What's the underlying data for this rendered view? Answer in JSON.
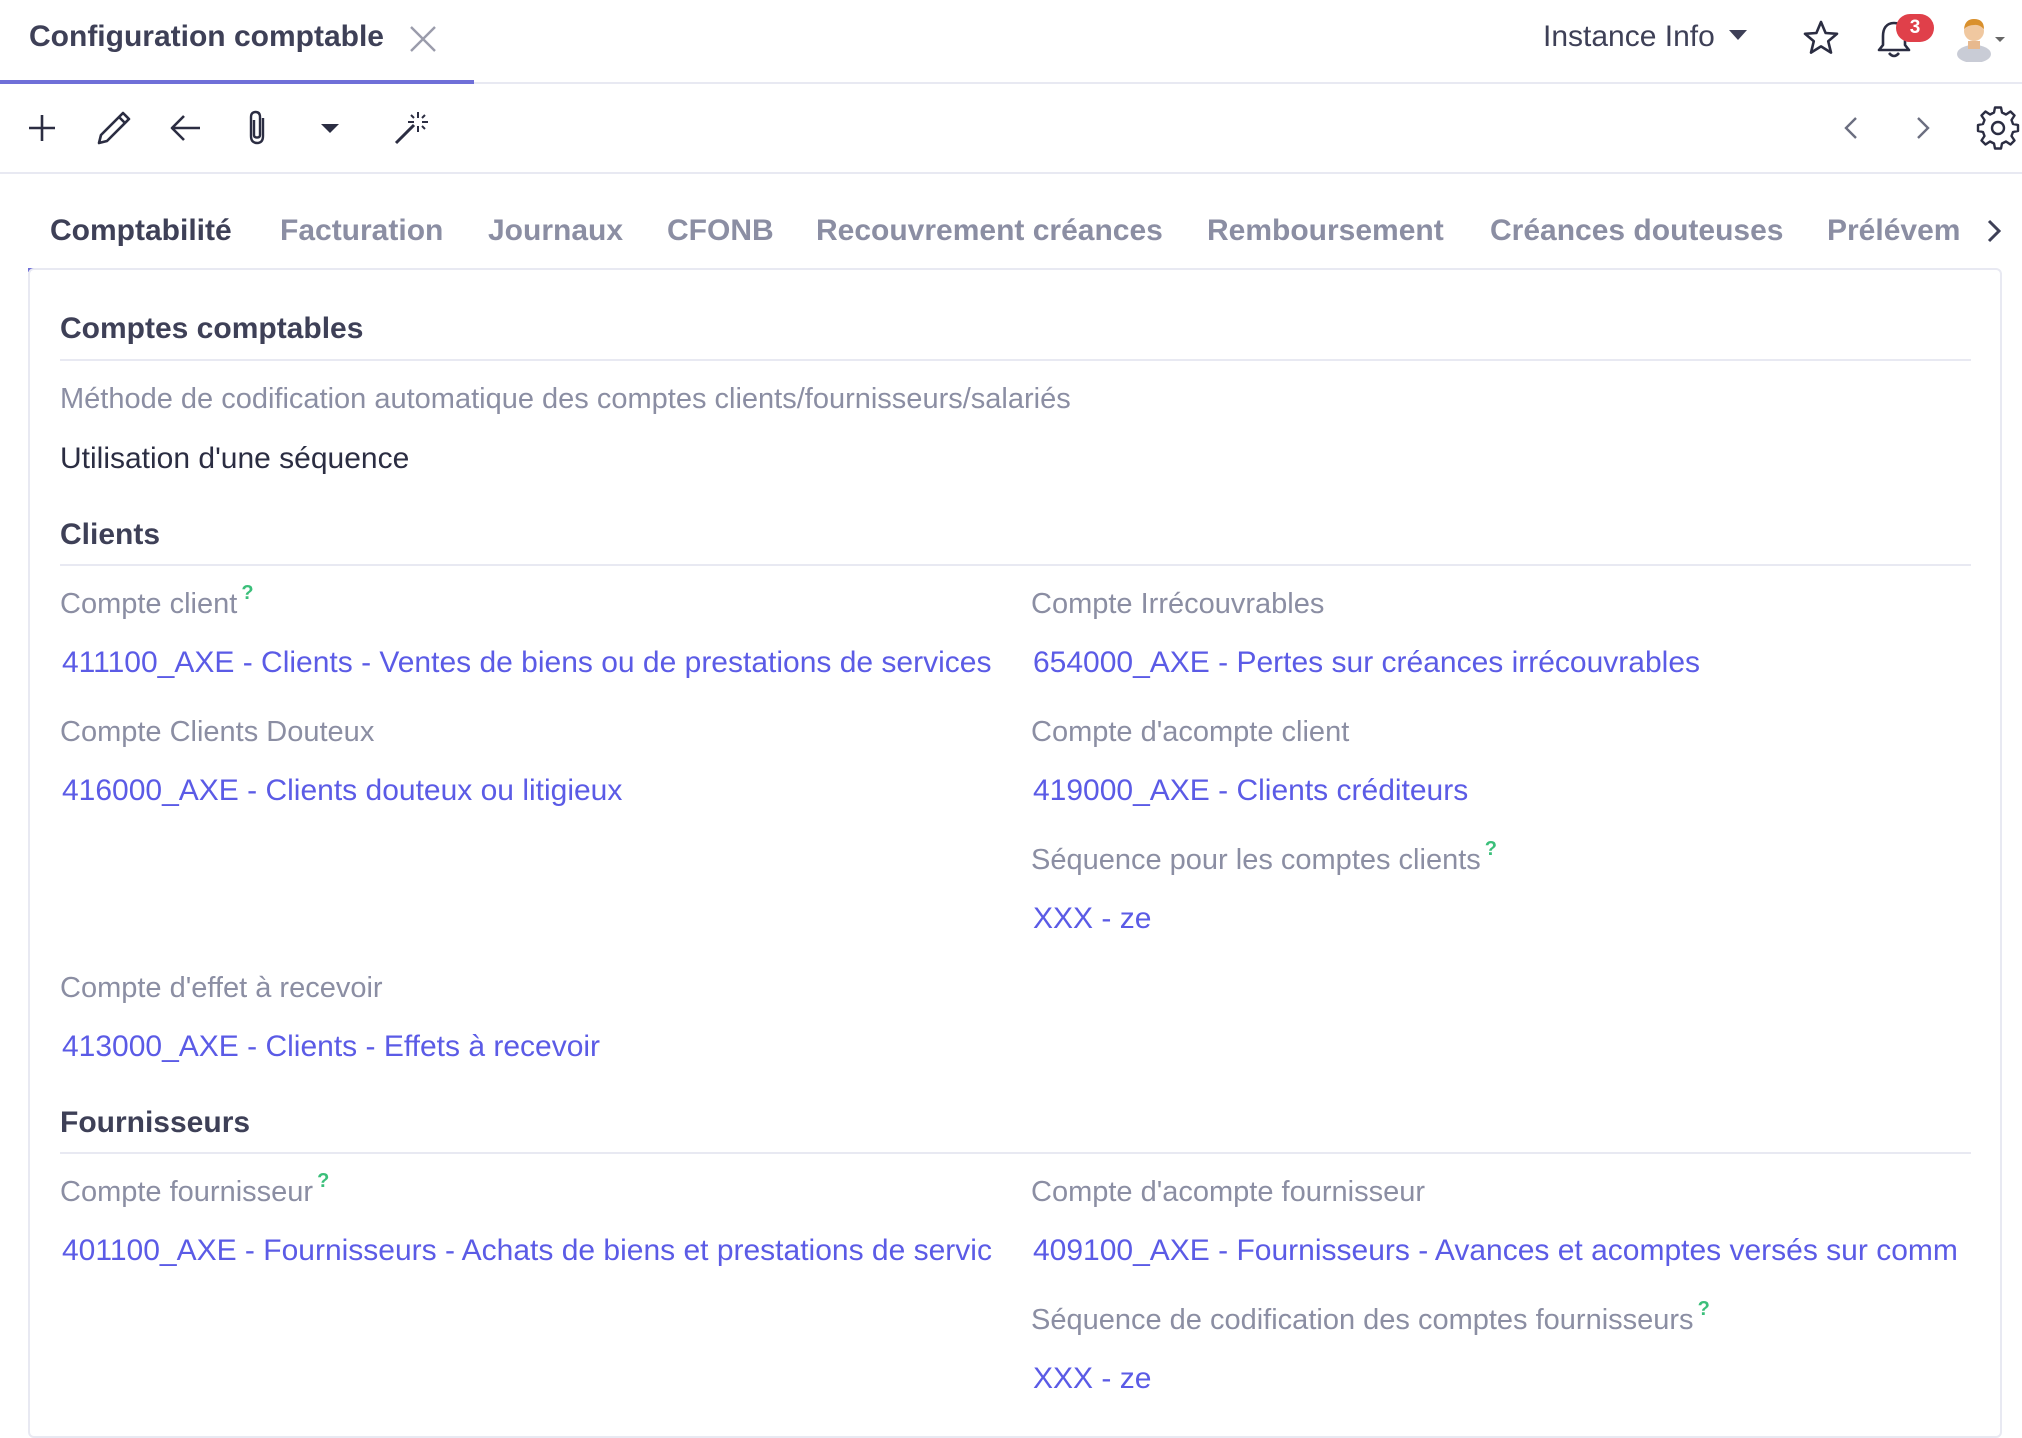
{
  "header": {
    "doc_title": "Configuration comptable",
    "instance_label": "Instance Info",
    "notification_count": "3"
  },
  "icons": {
    "close": "close-icon",
    "caret": "chevron-down-icon",
    "star": "star-icon",
    "bell": "bell-icon",
    "avatar": "user-avatar-icon",
    "new": "plus-icon",
    "edit": "pencil-icon",
    "back": "arrow-left-icon",
    "attach": "paperclip-icon",
    "more": "caret-down-icon",
    "wizard": "magic-wand-icon",
    "prev": "chevron-left-icon",
    "next": "chevron-right-icon",
    "settings": "gear-icon"
  },
  "tabs": [
    {
      "label": "Comptabilité",
      "active": true
    },
    {
      "label": "Facturation"
    },
    {
      "label": "Journaux"
    },
    {
      "label": "CFONB"
    },
    {
      "label": "Recouvrement créances"
    },
    {
      "label": "Remboursement"
    },
    {
      "label": "Créances douteuses"
    },
    {
      "label": "Prélévem"
    }
  ],
  "sections": {
    "accounts": {
      "title": "Comptes comptables",
      "method_label": "Méthode de codification automatique des comptes clients/fournisseurs/salariés",
      "method_value": "Utilisation d'une séquence"
    },
    "clients": {
      "title": "Clients",
      "customer_account_label": "Compte client",
      "customer_account_value": "411100_AXE - Clients - Ventes de biens ou de prestations de services",
      "irrecoverable_label": "Compte Irrécouvrables",
      "irrecoverable_value": "654000_AXE - Pertes sur créances irrécouvrables",
      "doubtful_label": "Compte Clients Douteux",
      "doubtful_value": "416000_AXE - Clients douteux ou litigieux",
      "advance_label": "Compte d'acompte client",
      "advance_value": "419000_AXE - Clients créditeurs",
      "sequence_label": "Séquence pour les comptes clients",
      "sequence_value": "XXX - ze",
      "bill_label": "Compte d'effet à recevoir",
      "bill_value": "413000_AXE - Clients - Effets à recevoir"
    },
    "suppliers": {
      "title": "Fournisseurs",
      "supplier_account_label": "Compte fournisseur",
      "supplier_account_value": "401100_AXE - Fournisseurs - Achats de biens et prestations de servic",
      "advance_label": "Compte d'acompte fournisseur",
      "advance_value": "409100_AXE - Fournisseurs - Avances et acomptes versés sur comm",
      "sequence_label": "Séquence de codification des comptes fournisseurs",
      "sequence_value": "XXX - ze"
    }
  },
  "help_mark": "?",
  "colors": {
    "accent": "#6f6fd8",
    "link": "#5b5be6",
    "badge": "#e0404a",
    "help": "#3bbf7a"
  }
}
